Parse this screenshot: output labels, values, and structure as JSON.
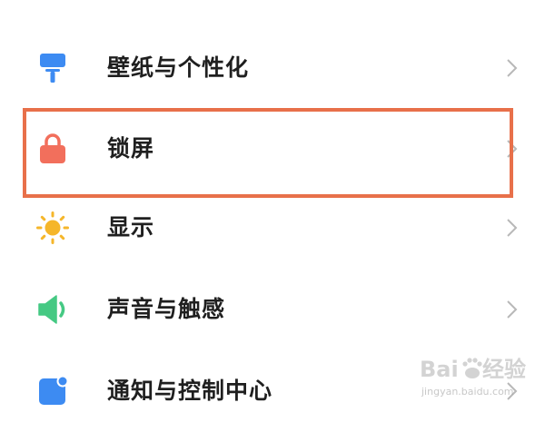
{
  "settings": {
    "items": [
      {
        "label": "壁纸与个性化",
        "icon": "wallpaper-icon"
      },
      {
        "label": "锁屏",
        "icon": "lock-icon"
      },
      {
        "label": "显示",
        "icon": "sun-icon"
      },
      {
        "label": "声音与触感",
        "icon": "speaker-icon"
      },
      {
        "label": "通知与控制中心",
        "icon": "notification-icon"
      }
    ],
    "highlighted_item": "锁屏"
  },
  "colors": {
    "wallpaper_icon": "#3D8BF2",
    "lock_icon": "#F26F5C",
    "sun_icon": "#F5B62A",
    "speaker_icon": "#45C983",
    "notification_icon": "#3D8BF2",
    "highlight_border": "#E8704A",
    "label_text": "#1F1F1F",
    "chevron": "#B8B8B8"
  },
  "watermark": {
    "caption": "jingyan.baidu.com"
  }
}
